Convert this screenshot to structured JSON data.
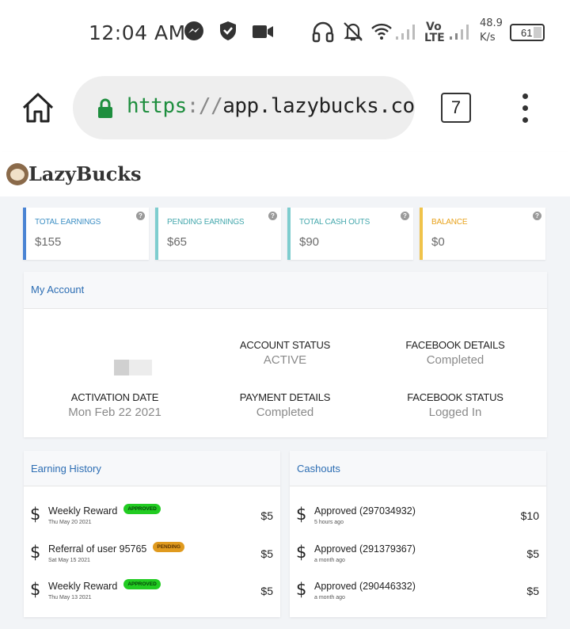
{
  "status_bar": {
    "time": "12:04 AM",
    "network_type_top": "Vo",
    "network_type_bottom": "LTE",
    "speed_value": "48.9",
    "speed_unit": "K/s",
    "battery": "61",
    "icons": [
      "messenger-icon",
      "shield-icon",
      "video-camera-icon",
      "headphones-icon",
      "notifications-off-icon",
      "wifi-icon",
      "signal-icon",
      "signal-icon",
      "battery-icon"
    ]
  },
  "browser": {
    "url_scheme": "https",
    "url_separator": "://",
    "url_host": "app.lazybucks.co",
    "tab_count": "7",
    "icons": [
      "home-icon",
      "lock-icon",
      "more-vert-icon"
    ]
  },
  "app": {
    "logo_text": "LazyBucks",
    "icons": [
      "sloth-logo-icon"
    ]
  },
  "stats": [
    {
      "label": "Total Earnings",
      "value": "$155",
      "accent": "#4a84d4",
      "label_color": "#3d8fc4"
    },
    {
      "label": "Pending Earnings",
      "value": "$65",
      "accent": "#7ecdcf",
      "label_color": "#45a8ad"
    },
    {
      "label": "Total Cash Outs",
      "value": "$90",
      "accent": "#7ecdcf",
      "label_color": "#45a8ad"
    },
    {
      "label": "Balance",
      "value": "$0",
      "accent": "#f0c34a",
      "label_color": "#e8a21c"
    }
  ],
  "account": {
    "title": "My Account",
    "account_status_label": "ACCOUNT STATUS",
    "account_status_value": "ACTIVE",
    "facebook_details_label": "FACEBOOK DETAILS",
    "facebook_details_value": "Completed",
    "activation_date_label": "ACTIVATION DATE",
    "activation_date_value": "Mon Feb 22 2021",
    "payment_details_label": "PAYMENT DETAILS",
    "payment_details_value": "Completed",
    "facebook_status_label": "FACEBOOK STATUS",
    "facebook_status_value": "Logged In"
  },
  "earning_history": {
    "title": "Earning History",
    "rows": [
      {
        "title": "Weekly Reward",
        "badge": "APPROVED",
        "badge_type": "approved",
        "date": "Thu May 20 2021",
        "amount": "$5"
      },
      {
        "title": "Referral of user 95765",
        "badge": "PENDING",
        "badge_type": "pending",
        "date": "Sat May 15 2021",
        "amount": "$5"
      },
      {
        "title": "Weekly Reward",
        "badge": "APPROVED",
        "badge_type": "approved",
        "date": "Thu May 13 2021",
        "amount": "$5"
      }
    ]
  },
  "cashouts": {
    "title": "Cashouts",
    "rows": [
      {
        "title": "Approved (297034932)",
        "date": "5 hours ago",
        "amount": "$10"
      },
      {
        "title": "Approved (291379367)",
        "date": "a month ago",
        "amount": "$5"
      },
      {
        "title": "Approved (290446332)",
        "date": "a month ago",
        "amount": "$5"
      }
    ]
  },
  "colors": {
    "brand_blue": "#2c6db3",
    "approved": "#22cc22",
    "pending": "#e09a1e",
    "url_green": "#1e8e3e"
  },
  "currency_symbol": "$"
}
